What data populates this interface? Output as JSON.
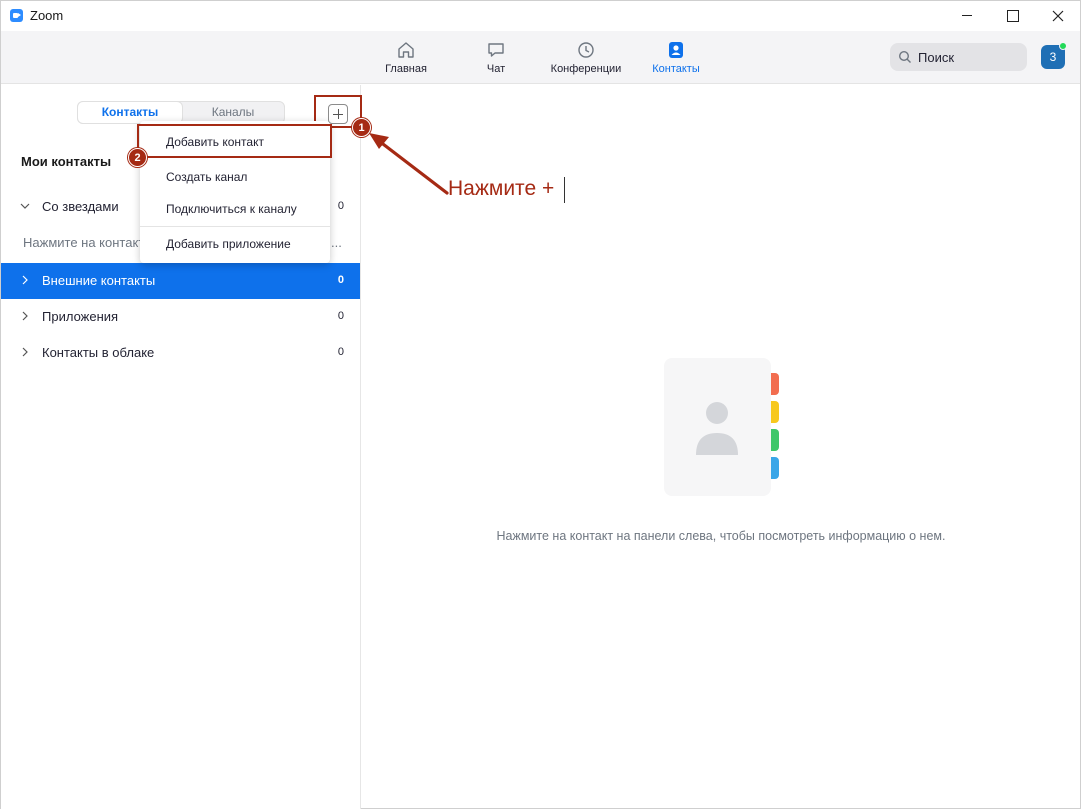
{
  "window": {
    "title": "Zoom"
  },
  "nav": {
    "items": [
      {
        "label": "Главная",
        "icon": "home-icon"
      },
      {
        "label": "Чат",
        "icon": "chat-icon"
      },
      {
        "label": "Конференции",
        "icon": "clock-icon"
      },
      {
        "label": "Контакты",
        "icon": "contacts-icon",
        "active": true
      }
    ],
    "search_placeholder": "Поиск",
    "avatar_text": "3",
    "accent_color": "#0e71eb"
  },
  "left": {
    "segments": {
      "contacts": "Контакты",
      "channels": "Каналы"
    },
    "section_title": "Мои контакты",
    "groups": {
      "starred": {
        "label": "Со звездами",
        "count": "0"
      },
      "hint": {
        "label": "Нажмите на контакт",
        "ellipsis": "..."
      },
      "external": {
        "label": "Внешние контакты",
        "count": "0"
      },
      "apps": {
        "label": "Приложения",
        "count": "0"
      },
      "cloud": {
        "label": "Контакты в облаке",
        "count": "0"
      }
    }
  },
  "dropdown": {
    "add_contact": "Добавить контакт",
    "create_channel": "Создать канал",
    "join_channel": "Подключиться к каналу",
    "add_app": "Добавить приложение"
  },
  "annotations": {
    "badge_1": "1",
    "badge_2": "2",
    "instruction": "Нажмите +",
    "color": "#a52a14"
  },
  "main": {
    "empty_message": "Нажмите на контакт на панели слева, чтобы посмотреть информацию о нем."
  }
}
